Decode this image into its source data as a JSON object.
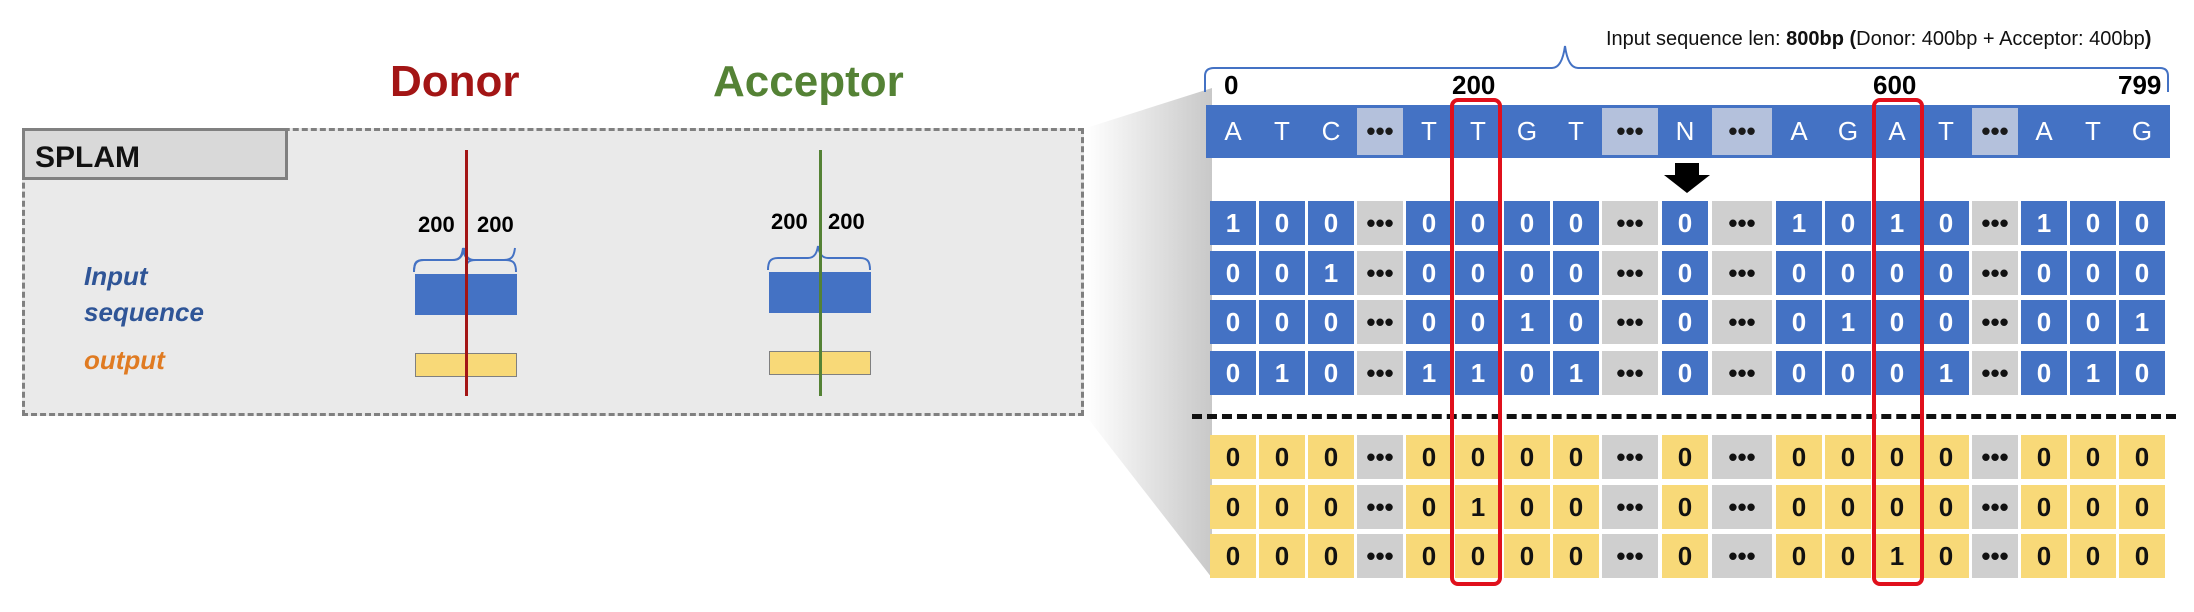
{
  "left": {
    "donor_title": "Donor",
    "acceptor_title": "Acceptor",
    "model_label": "SPLAM",
    "input_label_line1": "Input",
    "input_label_line2": "sequence",
    "output_label": "output",
    "flank_left": "200",
    "flank_right": "200"
  },
  "right": {
    "header_prefix": "Input sequence len: ",
    "header_bold": "800bp",
    "header_paren_open": " (",
    "header_detail": "Donor: 400bp + Acceptor: 400bp",
    "header_paren_close": ")",
    "axis_labels": [
      "0",
      "200",
      "600",
      "799"
    ],
    "sequence": [
      "A",
      "T",
      "C",
      "•••",
      "T",
      "T",
      "G",
      "T",
      "•••",
      "N",
      "•••",
      "A",
      "G",
      "A",
      "T",
      "•••",
      "A",
      "T",
      "G"
    ],
    "onehot": [
      [
        "1",
        "0",
        "0",
        "•••",
        "0",
        "0",
        "0",
        "0",
        "•••",
        "0",
        "•••",
        "1",
        "0",
        "1",
        "0",
        "•••",
        "1",
        "0",
        "0"
      ],
      [
        "0",
        "0",
        "1",
        "•••",
        "0",
        "0",
        "0",
        "0",
        "•••",
        "0",
        "•••",
        "0",
        "0",
        "0",
        "0",
        "•••",
        "0",
        "0",
        "0"
      ],
      [
        "0",
        "0",
        "0",
        "•••",
        "0",
        "0",
        "1",
        "0",
        "•••",
        "0",
        "•••",
        "0",
        "1",
        "0",
        "0",
        "•••",
        "0",
        "0",
        "1"
      ],
      [
        "0",
        "1",
        "0",
        "•••",
        "1",
        "1",
        "0",
        "1",
        "•••",
        "0",
        "•••",
        "0",
        "0",
        "0",
        "1",
        "•••",
        "0",
        "1",
        "0"
      ]
    ],
    "labels": [
      [
        "0",
        "0",
        "0",
        "•••",
        "0",
        "0",
        "0",
        "0",
        "•••",
        "0",
        "•••",
        "0",
        "0",
        "0",
        "0",
        "•••",
        "0",
        "0",
        "0"
      ],
      [
        "0",
        "0",
        "0",
        "•••",
        "0",
        "1",
        "0",
        "0",
        "•••",
        "0",
        "•••",
        "0",
        "0",
        "0",
        "0",
        "•••",
        "0",
        "0",
        "0"
      ],
      [
        "0",
        "0",
        "0",
        "•••",
        "0",
        "0",
        "0",
        "0",
        "•••",
        "0",
        "•••",
        "0",
        "0",
        "1",
        "0",
        "•••",
        "0",
        "0",
        "0"
      ]
    ]
  },
  "colors": {
    "donor": "#a31515",
    "acceptor": "#548235",
    "input_label": "#2f5597",
    "output_label": "#e07b22",
    "sequence_cell": "#4472c4",
    "label_cell": "#f8d978",
    "highlight": "#e0101c"
  }
}
